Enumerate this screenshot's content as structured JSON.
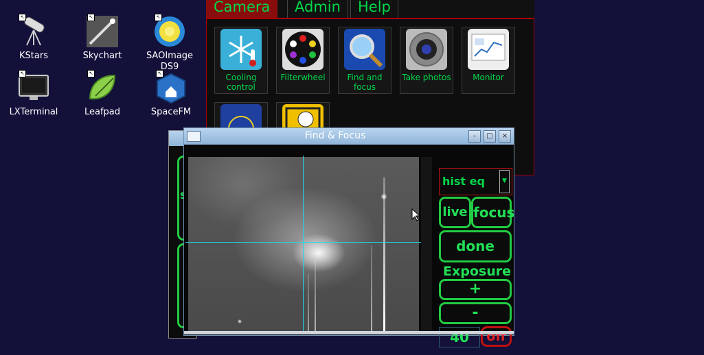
{
  "desktop": {
    "icons": [
      {
        "label": "KStars",
        "icon": "telescope-icon"
      },
      {
        "label": "Skychart",
        "icon": "comet-icon"
      },
      {
        "label": "SAOImage DS9",
        "icon": "sun-icon"
      },
      {
        "label": "LXTerminal",
        "icon": "monitor-icon"
      },
      {
        "label": "Leafpad",
        "icon": "leaf-pen-icon"
      },
      {
        "label": "SpaceFM",
        "icon": "home-cube-icon"
      }
    ]
  },
  "launcher": {
    "menu": [
      "Camera",
      "Admin",
      "Help"
    ],
    "active_tab": "Camera",
    "apps": [
      {
        "label": "Cooling control",
        "icon": "snowflake-thermometer-icon"
      },
      {
        "label": "Filterwheel",
        "icon": "filter-wheel-icon"
      },
      {
        "label": "Find and focus",
        "icon": "magnifier-icon"
      },
      {
        "label": "Take photos",
        "icon": "camera-lens-icon"
      },
      {
        "label": "Monitor",
        "icon": "chart-monitor-icon"
      }
    ]
  },
  "findfocus": {
    "title": "Find & Focus",
    "window_buttons": {
      "minimize": "–",
      "maximize": "□",
      "close": "×"
    },
    "stretch_select": "hist eq",
    "buttons": {
      "live": "live",
      "focus": "focus",
      "done": "done",
      "plus": "+",
      "minus": "-",
      "off": "off"
    },
    "exposure_label": "Exposure",
    "exposure_value": "40"
  },
  "background_window": {
    "partial_text": "s"
  },
  "colors": {
    "accent_green": "#22e055",
    "alert_red": "#c01010",
    "crosshair": "#22d8e8"
  }
}
